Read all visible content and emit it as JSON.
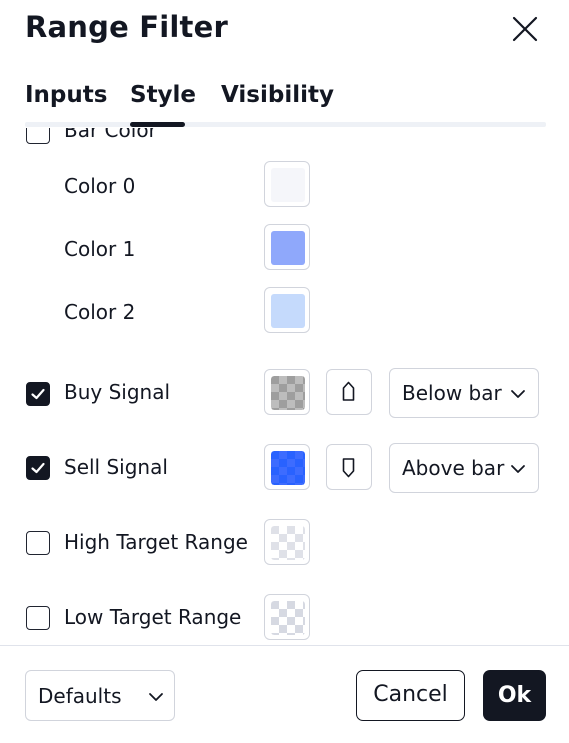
{
  "dialog": {
    "title": "Range Filter"
  },
  "tabs": [
    {
      "label": "Inputs",
      "active": false
    },
    {
      "label": "Style",
      "active": true
    },
    {
      "label": "Visibility",
      "active": false
    }
  ],
  "style": {
    "bar_color": {
      "label": "Bar Color",
      "checked": false
    },
    "colors": [
      {
        "label": "Color 0",
        "color": "#f5f6fa"
      },
      {
        "label": "Color 1",
        "color": "#8fa8fb"
      },
      {
        "label": "Color 2",
        "color": "#c5dafc"
      }
    ],
    "buy_signal": {
      "label": "Buy Signal",
      "checked": true,
      "color": "#9e9e9e",
      "shape_icon": "label-up-icon",
      "position": "Below bar"
    },
    "sell_signal": {
      "label": "Sell Signal",
      "checked": true,
      "color": "#2962ff",
      "shape_icon": "label-down-icon",
      "position": "Above bar"
    },
    "high_target_range": {
      "label": "High Target Range",
      "checked": false,
      "color": "transparent"
    },
    "low_target_range": {
      "label": "Low Target Range",
      "checked": false,
      "color": "transparent"
    }
  },
  "footer": {
    "defaults_label": "Defaults",
    "cancel_label": "Cancel",
    "ok_label": "Ok"
  }
}
